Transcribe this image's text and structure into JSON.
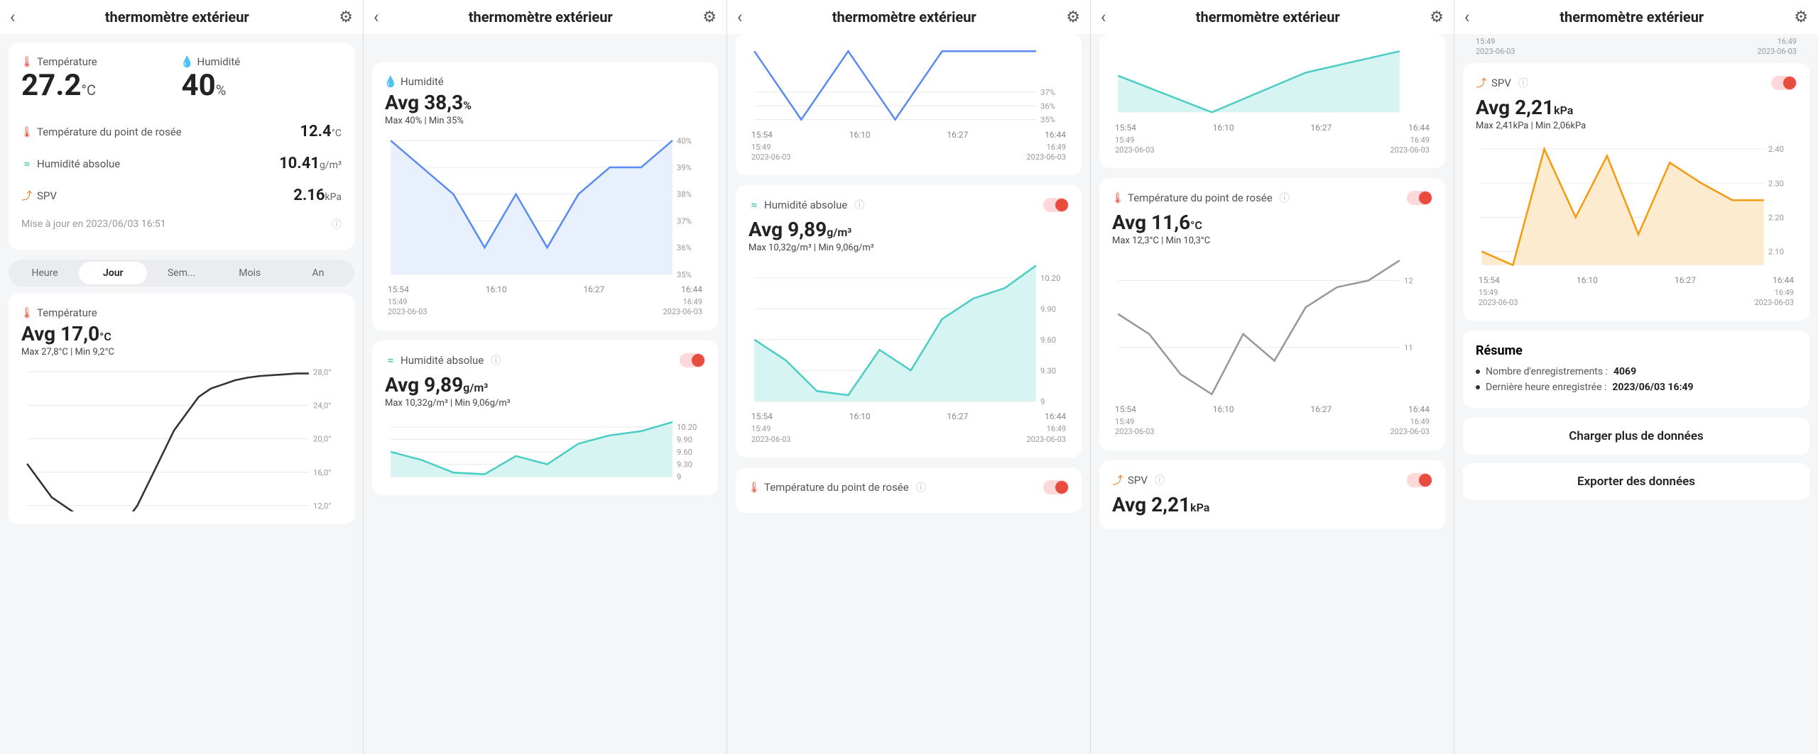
{
  "title": "thermomètre extérieur",
  "panel1": {
    "temp_label": "Température",
    "temp_value": "27.2",
    "temp_unit": "°C",
    "hum_label": "Humidité",
    "hum_value": "40",
    "hum_unit": "%",
    "dewpoint_label": "Température du point de rosée",
    "dewpoint_value": "12.4",
    "dewpoint_unit": "°C",
    "abshum_label": "Humidité absolue",
    "abshum_value": "10.41",
    "abshum_unit": "g/m³",
    "spv_label": "SPV",
    "spv_value": "2.16",
    "spv_unit": "kPa",
    "updated": "Mise à jour en 2023/06/03 16:51",
    "tabs": [
      "Heure",
      "Jour",
      "Sem...",
      "Mois",
      "An"
    ],
    "tab_active": 1,
    "temp_chart_label": "Température",
    "temp_avg": "Avg 17,0",
    "temp_avg_unit": "°C",
    "temp_maxmin": "Max 27,8°C | Min 9,2°C"
  },
  "panel2": {
    "hum_label": "Humidité",
    "hum_avg": "Avg 38,3",
    "hum_avg_unit": "%",
    "hum_maxmin": "Max 40% | Min 35%",
    "abshum_label": "Humidité absolue",
    "abshum_avg": "Avg 9,89",
    "abshum_avg_unit": "g/m³",
    "abshum_maxmin": "Max 10,32g/m³ | Min 9,06g/m³"
  },
  "panel3": {
    "abshum_label": "Humidité absolue",
    "abshum_avg": "Avg 9,89",
    "abshum_avg_unit": "g/m³",
    "abshum_maxmin": "Max 10,32g/m³ | Min 9,06g/m³",
    "dp_label": "Température du point de rosée"
  },
  "panel4": {
    "dp_label": "Température du point de rosée",
    "dp_avg": "Avg 11,6",
    "dp_avg_unit": "°C",
    "dp_maxmin": "Max 12,3°C | Min 10,3°C",
    "spv_label": "SPV",
    "spv_avg": "Avg 2,21",
    "spv_avg_unit": "kPa"
  },
  "panel5": {
    "spv_label": "SPV",
    "spv_avg": "Avg 2,21",
    "spv_avg_unit": "kPa",
    "spv_maxmin": "Max 2,41kPa | Min 2,06kPa",
    "resume_title": "Résume",
    "resume_records_label": "Nombre d'enregistrements :",
    "resume_records_value": "4069",
    "resume_last_label": "Dernière heure enregistrée :",
    "resume_last_value": "2023/06/03 16:49",
    "btn_load": "Charger plus de données",
    "btn_export": "Exporter des données",
    "top_time": "15:49",
    "top_date": "2023-06-03",
    "top_time2": "16:49",
    "top_date2": "2023-06-03"
  },
  "xticks": [
    "15:54",
    "16:10",
    "16:27",
    "16:44"
  ],
  "date_from_time": "15:49",
  "date_from_date": "2023-06-03",
  "date_to_time": "16:49",
  "date_to_date": "2023-06-03",
  "chart_data": [
    {
      "name": "temperature_day",
      "type": "line",
      "title": "Température",
      "ylabel": "°C",
      "ylim": [
        12,
        28
      ],
      "yticks": [
        12.0,
        16.0,
        20.0,
        24.0,
        28.0
      ],
      "x": [
        0,
        1,
        2,
        3,
        4,
        5,
        6,
        7,
        8,
        9,
        10,
        11,
        12,
        13,
        14,
        15,
        16,
        17,
        18,
        19,
        20,
        21,
        22,
        23
      ],
      "values": [
        17,
        15,
        13,
        12,
        11,
        10,
        9.5,
        9.2,
        10,
        12,
        15,
        18,
        21,
        23,
        25,
        26,
        26.5,
        27,
        27.3,
        27.5,
        27.6,
        27.7,
        27.8,
        27.8
      ]
    },
    {
      "name": "humidity",
      "type": "area",
      "title": "Humidité",
      "ylabel": "%",
      "ylim": [
        35,
        40
      ],
      "yticks": [
        35,
        36,
        37,
        38,
        39,
        40
      ],
      "x": [
        "15:54",
        "16:00",
        "16:05",
        "16:10",
        "16:15",
        "16:20",
        "16:27",
        "16:35",
        "16:40",
        "16:44"
      ],
      "values": [
        40,
        39,
        38,
        36,
        38,
        36,
        38,
        39,
        39,
        40
      ]
    },
    {
      "name": "humidity_top",
      "type": "line",
      "title": "Humidité",
      "ylabel": "%",
      "ylim": [
        35,
        40
      ],
      "yticks": [
        35,
        36,
        37
      ],
      "x": [
        "15:54",
        "16:00",
        "16:10",
        "16:15",
        "16:27",
        "16:35",
        "16:44"
      ],
      "values": [
        40,
        35,
        40,
        35,
        40,
        40,
        40
      ]
    },
    {
      "name": "abs_humidity",
      "type": "area",
      "title": "Humidité absolue",
      "ylabel": "g/m³",
      "ylim": [
        9.0,
        10.3
      ],
      "yticks": [
        9.0,
        9.3,
        9.6,
        9.9,
        10.2
      ],
      "x": [
        "15:54",
        "16:00",
        "16:05",
        "16:10",
        "16:15",
        "16:20",
        "16:27",
        "16:35",
        "16:40",
        "16:44"
      ],
      "values": [
        9.6,
        9.4,
        9.1,
        9.06,
        9.5,
        9.3,
        9.8,
        10.0,
        10.1,
        10.32
      ]
    },
    {
      "name": "abs_humidity_top",
      "type": "line",
      "title": "Humidité absolue partial",
      "ylabel": "g/m³",
      "ylim": [
        9.0,
        10.3
      ],
      "yticks": [
        9.0,
        9.3
      ],
      "x": [
        "15:54",
        "16:10",
        "16:27",
        "16:44"
      ],
      "values": [
        9.6,
        9.06,
        9.8,
        10.32
      ]
    },
    {
      "name": "dewpoint",
      "type": "line",
      "title": "Température du point de rosée",
      "ylabel": "°C",
      "ylim": [
        10.3,
        12.3
      ],
      "yticks": [
        11.0,
        12.0
      ],
      "x": [
        "15:54",
        "16:00",
        "16:05",
        "16:10",
        "16:15",
        "16:20",
        "16:27",
        "16:35",
        "16:40",
        "16:44"
      ],
      "values": [
        11.5,
        11.2,
        10.6,
        10.3,
        11.2,
        10.8,
        11.6,
        11.9,
        12.0,
        12.3
      ]
    },
    {
      "name": "dewpoint_top",
      "type": "area",
      "title": "Température du point de rosée partial",
      "ylabel": "°C",
      "ylim": [
        10.3,
        12.3
      ],
      "yticks": [
        9.0,
        9.3
      ],
      "x": [
        "15:54",
        "16:10",
        "16:27",
        "16:44"
      ],
      "values": [
        11.5,
        10.3,
        11.6,
        12.3
      ]
    },
    {
      "name": "spv",
      "type": "area",
      "title": "SPV",
      "ylabel": "kPa",
      "ylim": [
        2.06,
        2.41
      ],
      "yticks": [
        2.1,
        2.2,
        2.3,
        2.4
      ],
      "x": [
        "15:54",
        "16:00",
        "16:05",
        "16:10",
        "16:15",
        "16:20",
        "16:27",
        "16:35",
        "16:40",
        "16:44"
      ],
      "values": [
        2.1,
        2.06,
        2.4,
        2.2,
        2.38,
        2.15,
        2.36,
        2.3,
        2.25,
        2.25
      ]
    }
  ]
}
